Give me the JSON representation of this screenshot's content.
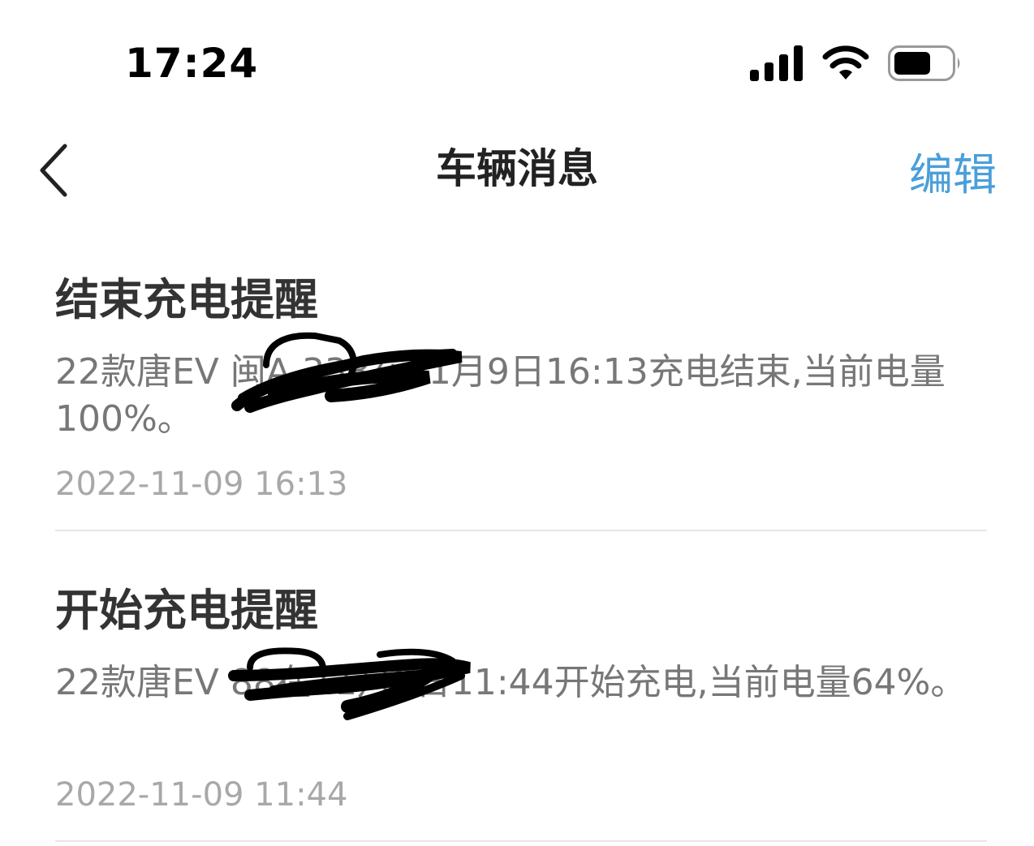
{
  "status_bar": {
    "time": "17:24",
    "icons": [
      "signal-icon",
      "wifi-icon",
      "battery-icon"
    ]
  },
  "nav": {
    "back_icon": "chevron-left-icon",
    "title": "车辆消息",
    "edit_label": "编辑"
  },
  "messages": [
    {
      "title": "结束充电提醒",
      "body": "22款唐EV 闽A  338在11月9日16:13充电结束,当前电量100%。",
      "time": "2022-11-09 16:13"
    },
    {
      "title": "开始充电提醒",
      "body": "22款唐EV      88在11月9日11:44开始充电,当前电量64%。",
      "time": "2022-11-09 11:44"
    }
  ],
  "colors": {
    "accent": "#4a9fda",
    "title_text": "#333333",
    "body_text": "#777777",
    "time_text": "#a8a8a8",
    "divider": "#e6e6e6"
  }
}
